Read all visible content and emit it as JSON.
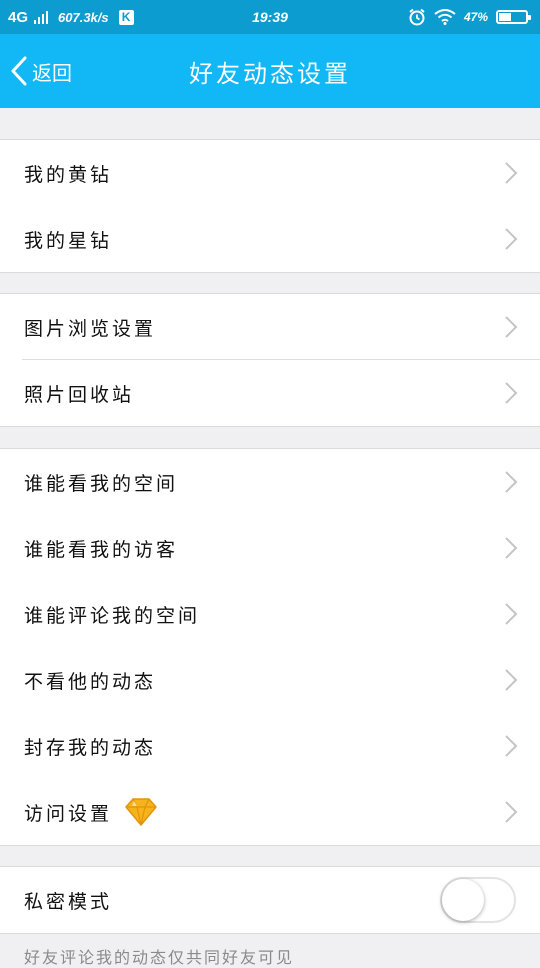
{
  "status_bar": {
    "network": "4G",
    "speed": "607.3k/s",
    "app_badge": "K",
    "time": "19:39",
    "battery_text": "47%",
    "battery_level": 0.47,
    "icons": [
      "signal-icon",
      "alarm-icon",
      "wifi-icon",
      "battery-icon"
    ]
  },
  "title_bar": {
    "back_label": "返回",
    "title": "好友动态设置"
  },
  "groups": [
    {
      "items": [
        {
          "label": "我的黄钻"
        },
        {
          "label": "我的星钻"
        }
      ]
    },
    {
      "items": [
        {
          "label": "图片浏览设置"
        },
        {
          "label": "照片回收站"
        }
      ]
    },
    {
      "items": [
        {
          "label": "谁能看我的空间"
        },
        {
          "label": "谁能看我的访客"
        },
        {
          "label": "谁能评论我的空间"
        },
        {
          "label": "不看他的动态"
        },
        {
          "label": "封存我的动态"
        },
        {
          "label": "访问设置",
          "badge_icon": "yellow-diamond-icon"
        }
      ]
    },
    {
      "items": [
        {
          "label": "私密模式",
          "toggle_on": false
        }
      ]
    }
  ],
  "footer_note": "好友评论我的动态仅共同好友可见",
  "colors": {
    "status_bar": "#0d9ccf",
    "title_bar": "#12b7f5",
    "background": "#f0f0f2",
    "diamond": "#f6b31c"
  }
}
